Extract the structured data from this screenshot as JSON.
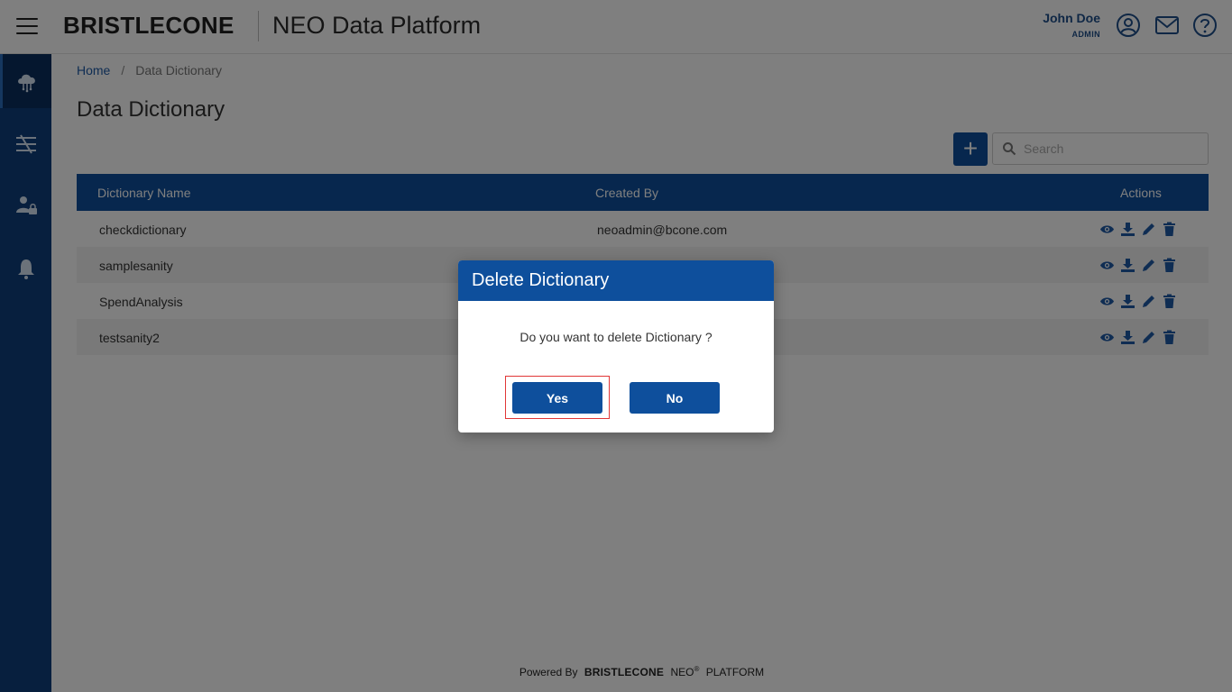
{
  "header": {
    "brand": "BRISTLECONE",
    "app_title": "NEO Data Platform",
    "user_name": "John Doe",
    "user_role": "ADMIN"
  },
  "sidebar": {
    "items": [
      {
        "name": "cloud-data-icon",
        "active": true
      },
      {
        "name": "pipeline-icon",
        "active": false
      },
      {
        "name": "user-admin-icon",
        "active": false
      },
      {
        "name": "bell-icon",
        "active": false
      }
    ]
  },
  "breadcrumb": {
    "home": "Home",
    "separator": "/",
    "current": "Data Dictionary"
  },
  "page": {
    "title": "Data Dictionary",
    "add_label": "+",
    "search_placeholder": "Search"
  },
  "table": {
    "headers": [
      "Dictionary Name",
      "Created By",
      "Actions"
    ],
    "rows": [
      {
        "name": "checkdictionary",
        "created_by": "neoadmin@bcone.com"
      },
      {
        "name": "samplesanity",
        "created_by": ""
      },
      {
        "name": "SpendAnalysis",
        "created_by": ""
      },
      {
        "name": "testsanity2",
        "created_by": ""
      }
    ],
    "action_icons": [
      "eye-icon",
      "download-icon",
      "pencil-icon",
      "trash-icon"
    ]
  },
  "footer": {
    "powered_by": "Powered By",
    "brand": "BRISTLECONE",
    "neo": "NEO",
    "reg": "®",
    "platform": "PLATFORM"
  },
  "modal": {
    "title": "Delete Dictionary",
    "message": "Do you want to delete Dictionary ?",
    "yes_label": "Yes",
    "no_label": "No"
  },
  "colors": {
    "primary": "#0e4f9c",
    "sidebar": "#0e3f7c",
    "highlight_outline": "#e13636"
  }
}
